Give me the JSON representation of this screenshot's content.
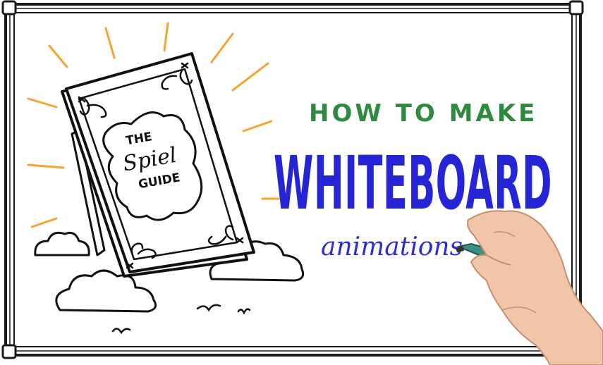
{
  "title": {
    "line1": "HOW TO MAKE",
    "line2": "WHITEBOARD",
    "line3": "animations"
  },
  "book": {
    "line1": "THE",
    "line2": "Spiel",
    "line3": "GUIDE"
  },
  "colors": {
    "frame": "#1a1a1a",
    "board": "#ffffff",
    "line1": "#2e8b3e",
    "line2": "#2525d6",
    "line3": "#2b2bd8",
    "rays": "#f2a533",
    "ink": "#111111",
    "marker_cap": "#e0202a",
    "marker_body": "#3c8f86",
    "skin": "#f1c6a8"
  },
  "icons": [
    "whiteboard-frame",
    "book-illustration",
    "cloud-icon",
    "bird-icon",
    "sun-ray",
    "hand-with-marker"
  ]
}
